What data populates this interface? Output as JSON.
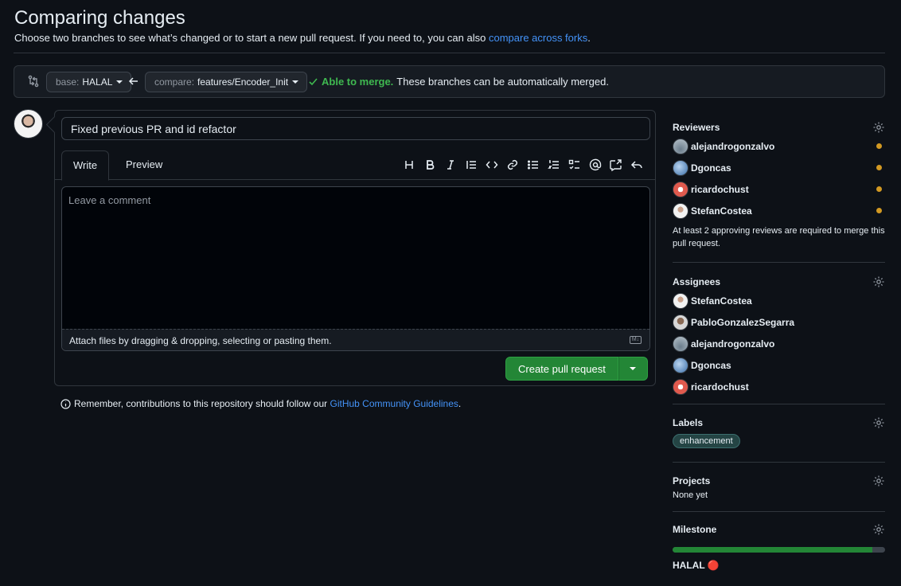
{
  "header": {
    "title": "Comparing changes",
    "subtitle": "Choose two branches to see what’s changed or to start a new pull request. If you need to, you can also ",
    "subtitle_link": "compare across forks",
    "subtitle_end": "."
  },
  "compare": {
    "base_prefix": "base:",
    "base_branch": "HALAL",
    "compare_prefix": "compare:",
    "compare_branch": "features/Encoder_Init",
    "merge_ok": "Able to merge.",
    "merge_msg": "These branches can be automatically merged."
  },
  "form": {
    "title_value": "Fixed previous PR and id refactor",
    "tabs": [
      "Write",
      "Preview"
    ],
    "comment_placeholder": "Leave a comment",
    "attach_text": "Attach files by dragging & dropping, selecting or pasting them.",
    "submit_label": "Create pull request"
  },
  "reminder": {
    "text": "Remember, contributions to this repository should follow our ",
    "link": "GitHub Community Guidelines",
    "end": "."
  },
  "sidebar": {
    "reviewers": {
      "title": "Reviewers",
      "people": [
        "alejandrogonzalvo",
        "Dgoncas",
        "ricardochust",
        "StefanCostea"
      ],
      "note": "At least 2 approving reviews are required to merge this pull request."
    },
    "assignees": {
      "title": "Assignees",
      "people": [
        "StefanCostea",
        "PabloGonzalezSegarra",
        "alejandrogonzalvo",
        "Dgoncas",
        "ricardochust"
      ]
    },
    "labels": {
      "title": "Labels",
      "items": [
        "enhancement"
      ]
    },
    "projects": {
      "title": "Projects",
      "value": "None yet"
    },
    "milestone": {
      "title": "Milestone",
      "name": "HALAL 🔴",
      "progress": 0.94
    }
  },
  "colors": {
    "accent_green": "#238636",
    "link_blue": "#4493f8",
    "pending_dot": "#d29922"
  }
}
